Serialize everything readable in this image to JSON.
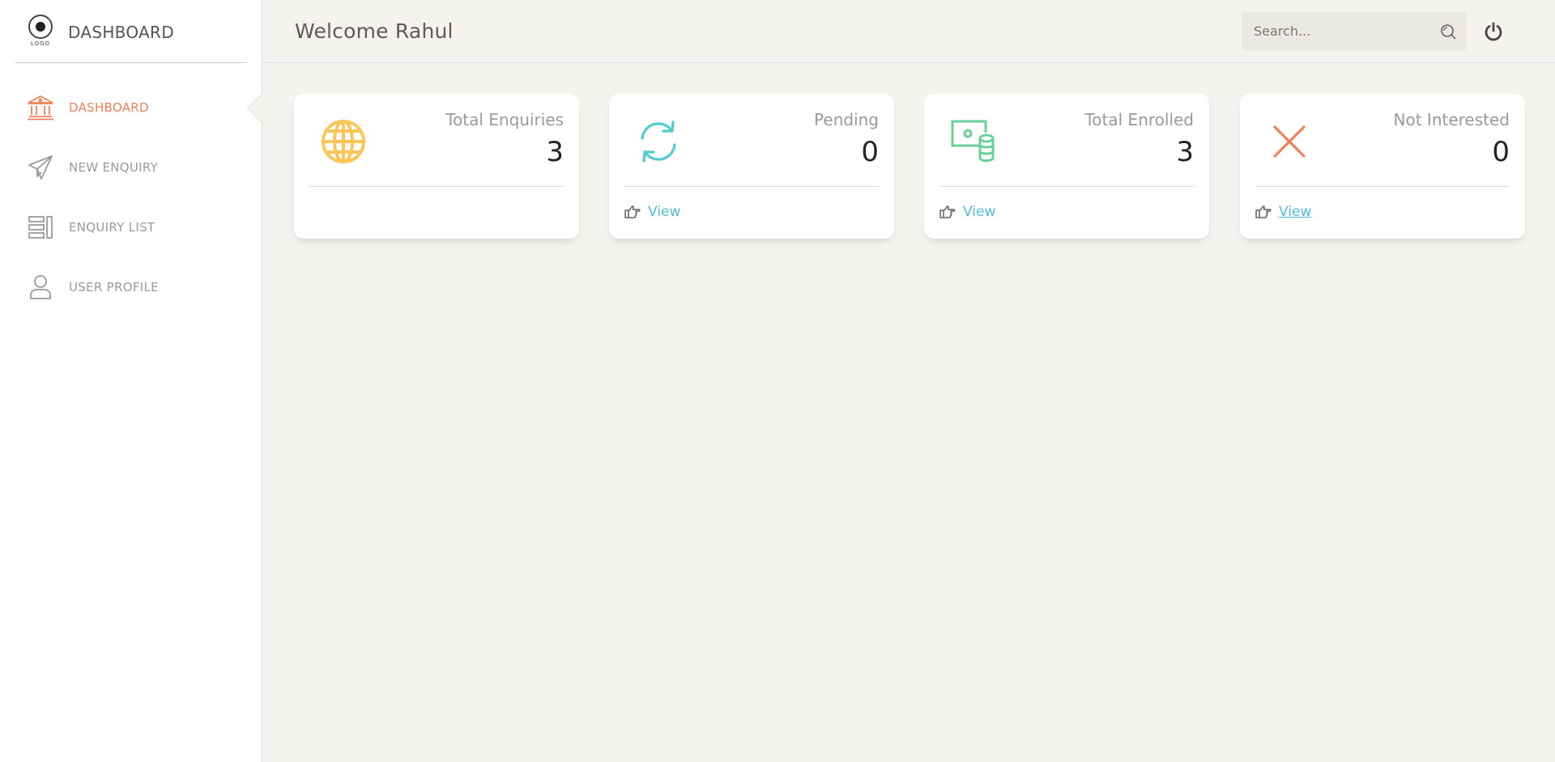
{
  "sidebar": {
    "brand": {
      "logo_text": "LOGO",
      "title": "DASHBOARD"
    },
    "items": [
      {
        "label": "DASHBOARD",
        "icon": "bank-icon",
        "active": true
      },
      {
        "label": "NEW ENQUIRY",
        "icon": "paper-plane-icon",
        "active": false
      },
      {
        "label": "ENQUIRY LIST",
        "icon": "list-icon",
        "active": false
      },
      {
        "label": "USER PROFILE",
        "icon": "user-icon",
        "active": false
      }
    ]
  },
  "header": {
    "welcome": "Welcome Rahul",
    "search": {
      "placeholder": "Search...",
      "value": ""
    },
    "power_icon": "power-icon"
  },
  "cards": [
    {
      "label": "Total Enquiries",
      "value": "3",
      "icon": "globe-icon",
      "icon_color": "#fbc658",
      "link": ""
    },
    {
      "label": "Pending",
      "value": "0",
      "icon": "refresh-icon",
      "icon_color": "#51cbce",
      "link": "View"
    },
    {
      "label": "Total Enrolled",
      "value": "3",
      "icon": "money-coins-icon",
      "icon_color": "#6bd098",
      "link": "View"
    },
    {
      "label": "Not Interested",
      "value": "0",
      "icon": "close-x-icon",
      "icon_color": "#ef8157",
      "link": "View"
    }
  ],
  "colors": {
    "accent": "#ef8157",
    "link": "#51bcda",
    "background": "#f4f3ef"
  }
}
